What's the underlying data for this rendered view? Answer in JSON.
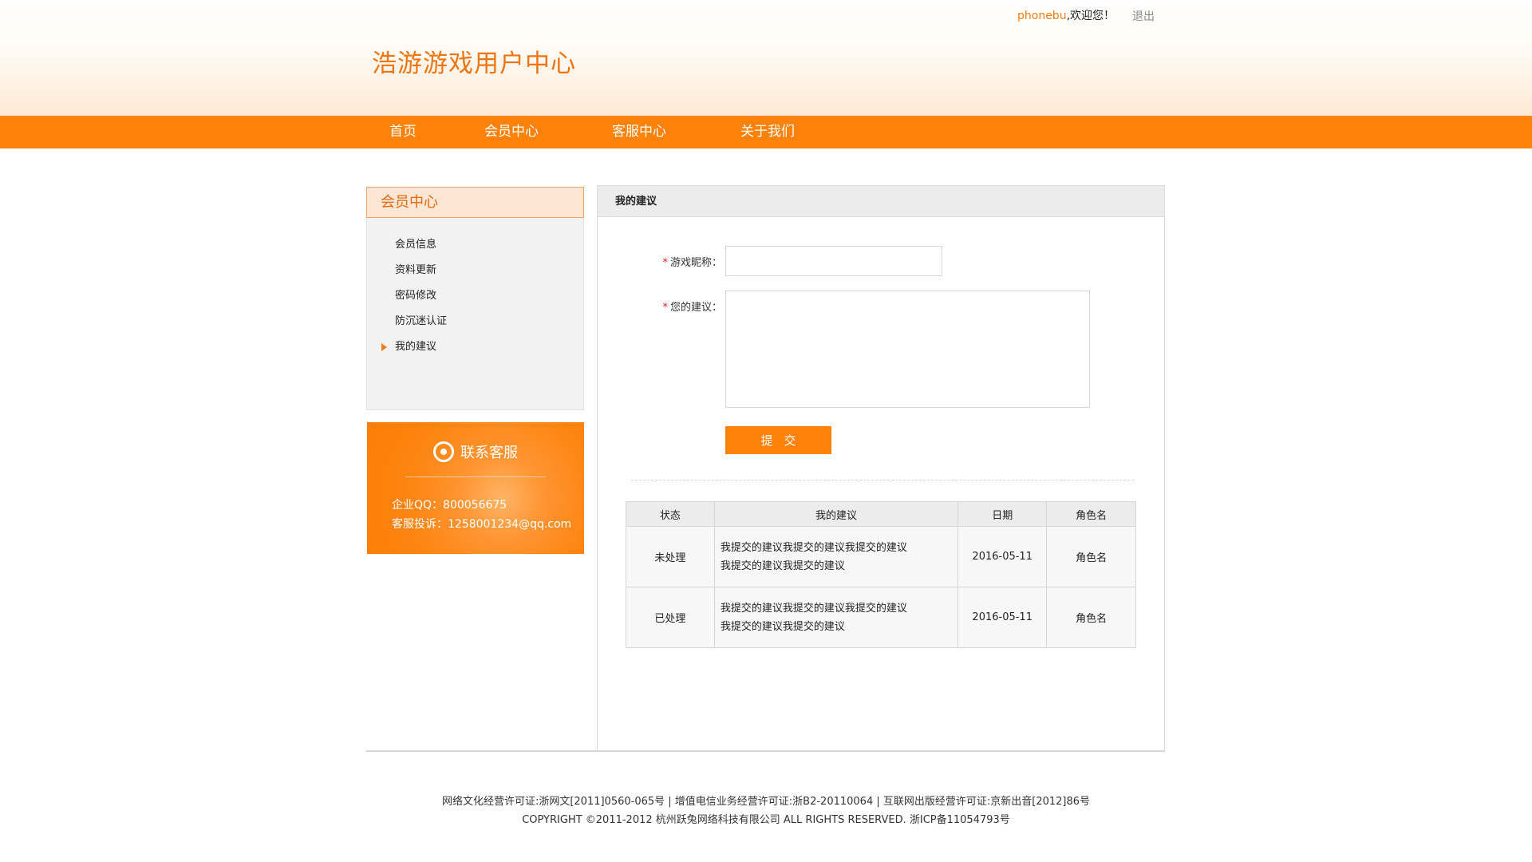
{
  "header": {
    "username": "phonebu",
    "welcome": ",欢迎您！",
    "logout": "退出",
    "site_title": "浩游游戏用户中心"
  },
  "nav": [
    "首页",
    "会员中心",
    "客服中心",
    "关于我们"
  ],
  "sidebar": {
    "title": "会员中心",
    "items": [
      {
        "label": "会员信息",
        "active": false
      },
      {
        "label": "资料更新",
        "active": false
      },
      {
        "label": "密码修改",
        "active": false
      },
      {
        "label": "防沉迷认证",
        "active": false
      },
      {
        "label": "我的建议",
        "active": true
      }
    ]
  },
  "contact": {
    "title": "联系客服",
    "qq": "企业QQ：800056675",
    "complaint": "客服投诉：1258001234@qq.com"
  },
  "main": {
    "title": "我的建议",
    "form": {
      "required_mark": "*",
      "nickname_label": "游戏昵称：",
      "nickname_value": "",
      "suggestion_label": "您的建议：",
      "suggestion_value": "",
      "submit_label": "提交"
    },
    "table": {
      "headers": [
        "状态",
        "我的建议",
        "日期",
        "角色名"
      ],
      "rows": [
        {
          "status": "未处理",
          "status_type": "pending",
          "line1": "我提交的建议我提交的建议我提交的建议",
          "line2": "我提交的建议我提交的建议",
          "date": "2016-05-11",
          "role": "角色名"
        },
        {
          "status": "已处理",
          "status_type": "done",
          "line1": "我提交的建议我提交的建议我提交的建议",
          "line2": "我提交的建议我提交的建议",
          "date": "2016-05-11",
          "role": "角色名"
        }
      ]
    }
  },
  "footer": {
    "line1": "网络文化经营许可证:浙网文[2011]0560-065号 | 增值电信业务经营许可证:浙B2-20110064 | 互联网出版经营许可证:京新出音[2012]86号",
    "line2": "COPYRIGHT ©2011-2012 杭州跃兔网络科技有限公司 ALL RIGHTS RESERVED.  浙ICP备11054793号"
  },
  "colors": {
    "accent": "#fe8208",
    "title": "#ef7511",
    "pending": "#e31b1b",
    "done": "#3aa61a"
  }
}
